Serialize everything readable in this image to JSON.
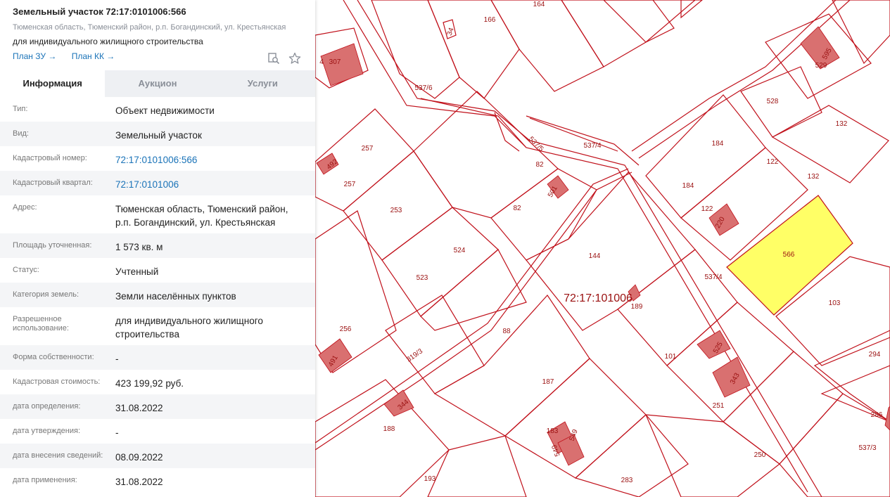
{
  "header": {
    "title": "Земельный участок 72:17:0101006:566",
    "address": "Тюменская область, Тюменский район, р.п. Богандинский, ул. Крестьянская",
    "use": "для индивидуального жилищного строительства",
    "link_plan_zu": "План ЗУ →",
    "link_plan_kk": "План КК →"
  },
  "icons": {
    "search": "search-icon",
    "favorite": "star-icon"
  },
  "tabs": [
    {
      "label": "Информация",
      "active": true
    },
    {
      "label": "Аукцион",
      "active": false
    },
    {
      "label": "Услуги",
      "active": false
    }
  ],
  "rows": [
    {
      "label": "Тип:",
      "value": "Объект недвижимости"
    },
    {
      "label": "Вид:",
      "value": "Земельный участок"
    },
    {
      "label": "Кадастровый номер:",
      "value": "72:17:0101006:566"
    },
    {
      "label": "Кадастровый квартал:",
      "value": "72:17:0101006"
    },
    {
      "label": "Адрес:",
      "value": "Тюменская область, Тюменский район, р.п. Богандинский, ул. Крестьянская"
    },
    {
      "label": "Площадь уточненная:",
      "value": "1 573 кв. м"
    },
    {
      "label": "Статус:",
      "value": "Учтенный"
    },
    {
      "label": "Категория земель:",
      "value": "Земли населённых пунктов"
    },
    {
      "label": "Разрешенное использование:",
      "value": "для индивидуального жилищного строительства"
    },
    {
      "label": "Форма собственности:",
      "value": "-"
    },
    {
      "label": "Кадастровая стоимость:",
      "value": "423 199,92 руб."
    },
    {
      "label": "дата определения:",
      "value": "31.08.2022"
    },
    {
      "label": "дата утверждения:",
      "value": "-"
    },
    {
      "label": "дата внесения сведений:",
      "value": "08.09.2022"
    },
    {
      "label": "дата применения:",
      "value": "31.08.2022"
    }
  ],
  "map": {
    "quarter_label": "72:17:101006",
    "selected_parcel": "566",
    "line_color": "#c0101a",
    "building_color": "#d97070",
    "selected_color": "#ffff66",
    "labels": [
      "164",
      "166",
      "34",
      "307",
      "4",
      "529",
      "595",
      "537/6",
      "528",
      "132",
      "537/4",
      "537/5",
      "184",
      "122",
      "132",
      "257",
      "492",
      "82",
      "257",
      "253",
      "501",
      "82",
      "184",
      "122",
      "220",
      "566",
      "524",
      "144",
      "523",
      "537/4",
      "72:17:101006",
      "189",
      "103",
      "256",
      "88",
      "101",
      "525",
      "294",
      "491",
      "319/3",
      "187",
      "343",
      "344",
      "251",
      "188",
      "183",
      "549",
      "549",
      "250",
      "286",
      "537/3",
      "193",
      "283"
    ]
  }
}
